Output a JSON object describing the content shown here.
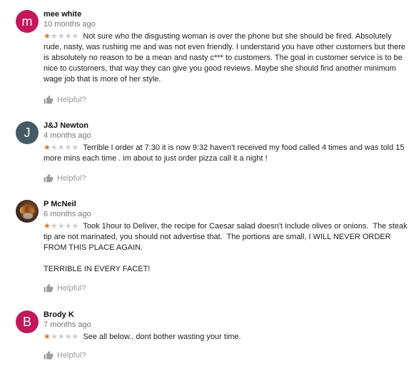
{
  "colors": {
    "star_filled": "#e7711b",
    "star_empty": "#cccccc",
    "avatar_m": "#c2185b",
    "avatar_j": "#455a64",
    "avatar_b": "#c2185b"
  },
  "reviews": [
    {
      "author": "mee white",
      "avatar_letter": "m",
      "avatar": "letter-avatar",
      "time": "10 months ago",
      "rating": 1,
      "paragraphs": [
        "Not sure who the disgusting woman is over the phone but she should be fired. Absolutely rude, nasty, was rushing me and was not even friendly. I understand you have other customers but there is absolutely no reason to be a mean and nasty c*** to customers. The goal in customer service is to be nice to customers, that way they can give you good reviews. Maybe she should find another minimum wage job that is more of her style."
      ],
      "helpful_label": "Helpful?"
    },
    {
      "author": "J&J Newton",
      "avatar_letter": "J",
      "avatar": "letter-avatar",
      "time": "4 months ago",
      "rating": 1,
      "paragraphs": [
        "Terrible I order at 7:30 it is now 9:32 haven't received my food called 4 times and was told 15 more mins each time . im about to just order pizza call it a night !"
      ],
      "helpful_label": "Helpful?"
    },
    {
      "author": "P McNeil",
      "avatar_letter": "",
      "avatar": "photo-avatar",
      "time": "6 months ago",
      "rating": 1,
      "paragraphs": [
        "Took 1hour to Deliver, the recipe for Caesar salad doesn't include olives or onions.  The steak tip are not marinated, you should not advertise that.  The portions are small, I WILL NEVER ORDER FROM THIS PLACE AGAIN.",
        "TERRIBLE IN EVERY FACET!"
      ],
      "helpful_label": "Helpful?"
    },
    {
      "author": "Brody K",
      "avatar_letter": "B",
      "avatar": "letter-avatar",
      "time": "7 months ago",
      "rating": 1,
      "paragraphs": [
        "See all below.. dont bother wasting your time."
      ],
      "helpful_label": "Helpful?"
    }
  ]
}
